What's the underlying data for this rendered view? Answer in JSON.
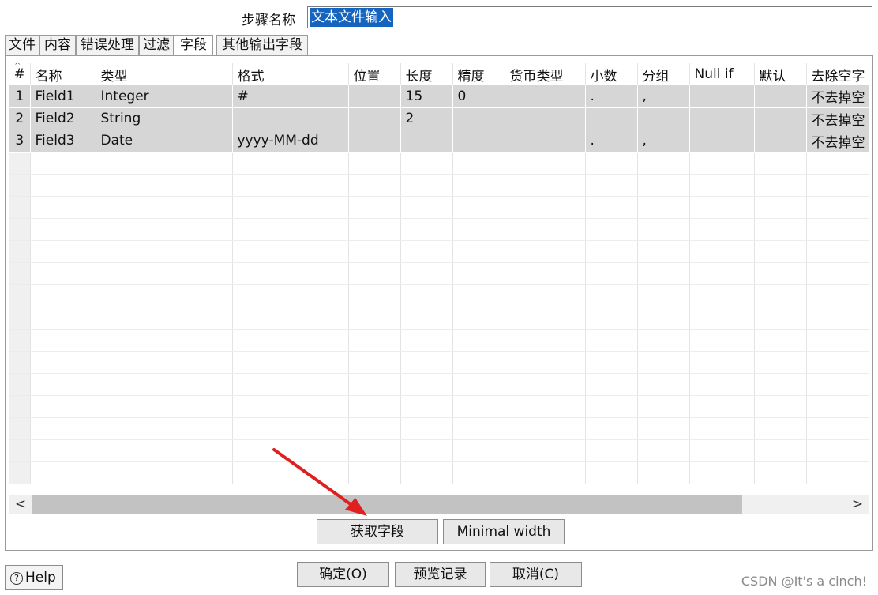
{
  "step": {
    "label": "步骤名称",
    "value": "文本文件输入"
  },
  "tabs": [
    {
      "label": "文件"
    },
    {
      "label": "内容"
    },
    {
      "label": "错误处理"
    },
    {
      "label": "过滤"
    },
    {
      "label": "字段",
      "active": true
    },
    {
      "label": "其他输出字段"
    }
  ],
  "table": {
    "columns": [
      "#",
      "名称",
      "类型",
      "格式",
      "位置",
      "长度",
      "精度",
      "货币类型",
      "小数",
      "分组",
      "Null if",
      "默认",
      "去除空字"
    ],
    "rows": [
      [
        "1",
        "Field1",
        "Integer",
        "#",
        "",
        "15",
        "0",
        "",
        ".",
        ",",
        "",
        "",
        "不去掉空"
      ],
      [
        "2",
        "Field2",
        "String",
        "",
        "",
        "2",
        "",
        "",
        "",
        "",
        "",
        "",
        "不去掉空"
      ],
      [
        "3",
        "Field3",
        "Date",
        "yyyy-MM-dd",
        "",
        "",
        "",
        "",
        ".",
        ",",
        "",
        "",
        "不去掉空"
      ]
    ]
  },
  "scroll": {
    "left_arrow": "<",
    "right_arrow": ">"
  },
  "buttons": {
    "get_fields": "获取字段",
    "minimal_width": "Minimal width",
    "ok": "确定(O)",
    "preview": "预览记录",
    "cancel": "取消(C)",
    "help": "Help"
  },
  "watermark": "CSDN @It's a cinch!",
  "colors": {
    "selection": "#1565c0",
    "row_fill": "#d6d6d6",
    "annotation_arrow": "#e02020"
  }
}
